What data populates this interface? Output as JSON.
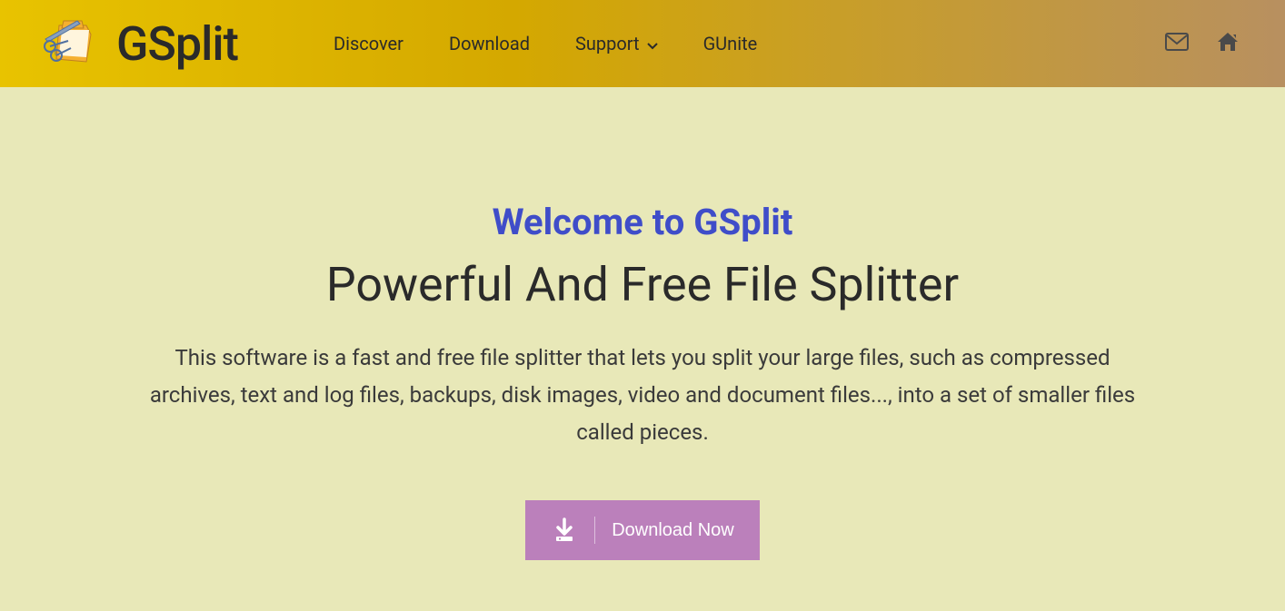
{
  "header": {
    "logo_text": "GSplit",
    "nav": {
      "discover": "Discover",
      "download": "Download",
      "support": "Support",
      "gunite": "GUnite"
    }
  },
  "hero": {
    "welcome": "Welcome to GSplit",
    "headline": "Powerful And Free File Splitter",
    "description": "This software is a fast and free file splitter that lets you split your large files, such as compressed archives, text and log files, backups, disk images, video and document files..., into a set of smaller files called pieces.",
    "download_button": "Download Now"
  }
}
